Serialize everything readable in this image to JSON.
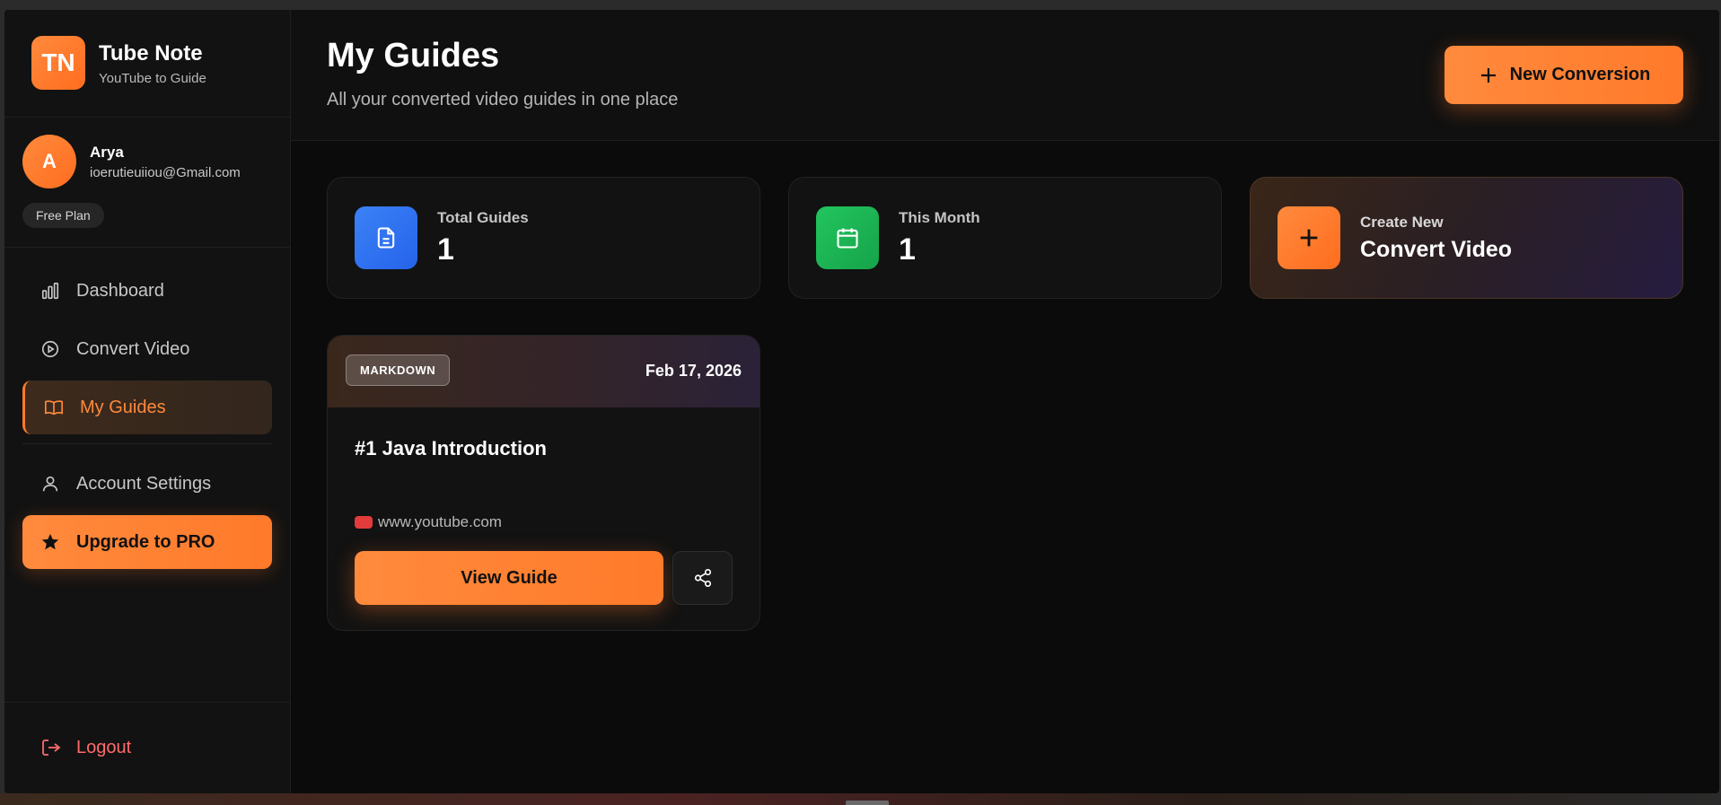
{
  "brand": {
    "logo": "TN",
    "title": "Tube Note",
    "subtitle": "YouTube to Guide"
  },
  "user": {
    "initial": "A",
    "name": "Arya",
    "email": "ioerutieuiiou@Gmail.com",
    "plan": "Free Plan"
  },
  "nav": [
    {
      "label": "Dashboard",
      "icon": "bar-chart-icon",
      "active": false
    },
    {
      "label": "Convert Video",
      "icon": "play-circle-icon",
      "active": false
    },
    {
      "label": "My Guides",
      "icon": "book-open-icon",
      "active": true
    },
    {
      "label": "Account Settings",
      "icon": "user-icon",
      "active": false
    }
  ],
  "upgrade": {
    "label": "Upgrade to PRO",
    "icon": "star-icon"
  },
  "logout": {
    "label": "Logout",
    "icon": "logout-icon"
  },
  "header": {
    "title": "My Guides",
    "subtitle": "All your converted video guides in one place",
    "new_button": "New Conversion"
  },
  "stats": {
    "total": {
      "label": "Total Guides",
      "value": "1",
      "icon": "document-icon"
    },
    "month": {
      "label": "This Month",
      "value": "1",
      "icon": "calendar-icon"
    },
    "create": {
      "label": "Create New",
      "title": "Convert Video",
      "icon": "plus-icon"
    }
  },
  "guides": [
    {
      "format": "MARKDOWN",
      "date": "Feb 17, 2026",
      "title": "#1 Java Introduction",
      "source": "www.youtube.com",
      "view_label": "View Guide"
    }
  ],
  "colors": {
    "accent": "#ff7a2a",
    "background": "#0b0b0b",
    "sidebar": "#121212",
    "blue": "#3b82f6",
    "green": "#22c55e",
    "danger": "#ff6b6b"
  }
}
